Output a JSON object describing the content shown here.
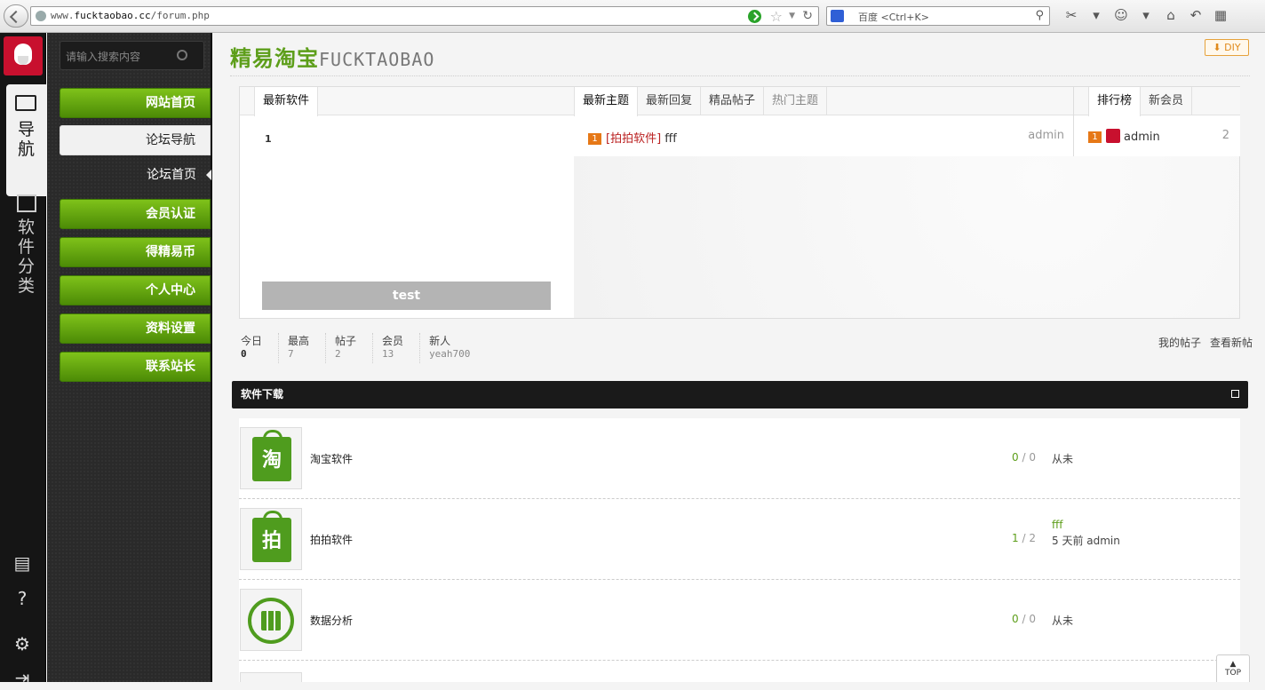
{
  "browser": {
    "url_prefix": "www.",
    "url_domain": "fucktaobao.cc",
    "url_path": "/forum.php",
    "search_engine": "百度",
    "search_placeholder": "<Ctrl+K>"
  },
  "leftnav": {
    "nav_label": "导\n航",
    "soft_label": "软\n件\n分\n类"
  },
  "menu": {
    "search_placeholder": "请输入搜索内容",
    "items": [
      "网站首页",
      "论坛导航",
      "论坛首页",
      "会员认证",
      "得精易币",
      "个人中心",
      "资料设置",
      "联系站长"
    ]
  },
  "page": {
    "title": "精易淘宝",
    "title_en": "FUCKTAOBAO",
    "diy": "DIY"
  },
  "panel": {
    "col1_tab": "最新软件",
    "col1_item": "1",
    "test_label": "test",
    "col2_tabs": [
      "最新主题",
      "最新回复",
      "精品帖子",
      "热门主题"
    ],
    "col2_row": {
      "num": "1",
      "cat": "[拍拍软件]",
      "title": "fff",
      "author": "admin"
    },
    "col3_tabs": [
      "排行榜",
      "新会员"
    ],
    "col3_row": {
      "num": "1",
      "name": "admin",
      "count": "2"
    }
  },
  "stats": [
    {
      "label": "今日",
      "value": "0"
    },
    {
      "label": "最高",
      "value": "7"
    },
    {
      "label": "帖子",
      "value": "2"
    },
    {
      "label": "会员",
      "value": "13"
    },
    {
      "label": "新人",
      "value": "yeah700"
    }
  ],
  "links": [
    "我的帖子",
    "查看新帖"
  ],
  "section": {
    "title": "软件下载"
  },
  "forums": [
    {
      "name": "淘宝软件",
      "icon": "淘",
      "today": "0",
      "total": "0",
      "last": "从未",
      "last2": ""
    },
    {
      "name": "拍拍软件",
      "icon": "拍",
      "today": "1",
      "total": "2",
      "last": "fff",
      "last2": "5 天前 admin"
    },
    {
      "name": "数据分析",
      "icon": "",
      "today": "0",
      "total": "0",
      "last": "从未",
      "last2": ""
    }
  ],
  "top_label": "TOP"
}
